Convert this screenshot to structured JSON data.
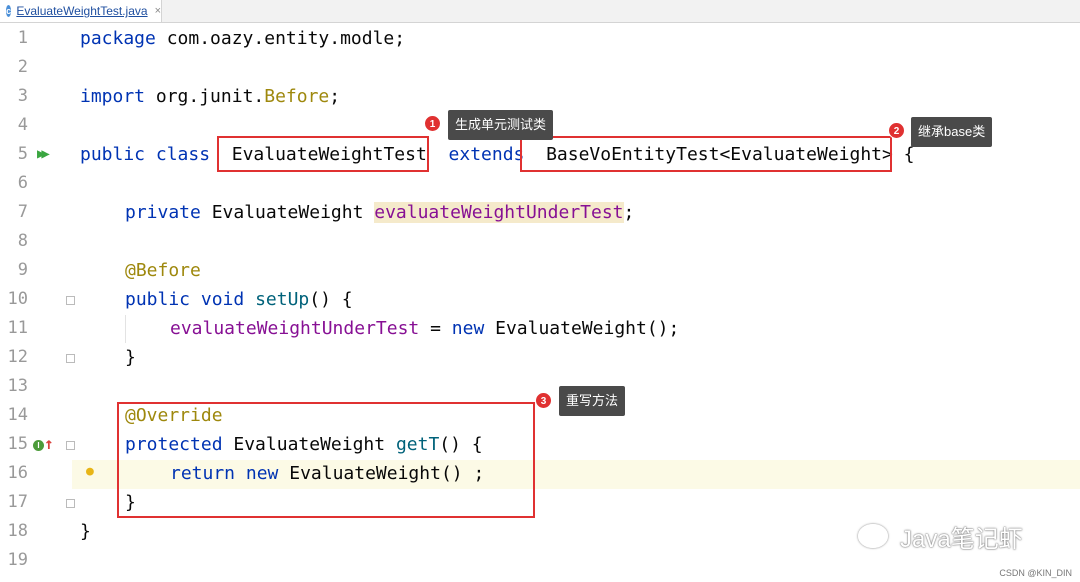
{
  "tab": {
    "filename": "EvaluateWeightTest.java",
    "icon": "java-class-icon",
    "close": "×"
  },
  "gutter": {
    "line_numbers": [
      "1",
      "2",
      "3",
      "4",
      "5",
      "6",
      "7",
      "8",
      "9",
      "10",
      "11",
      "12",
      "13",
      "14",
      "15",
      "16",
      "17",
      "18",
      "19"
    ]
  },
  "code": {
    "l1": {
      "kw": "package",
      "rest": " com.oazy.entity.modle;"
    },
    "l3": {
      "kw": "import",
      "pre": " org.junit.",
      "ann": "Before",
      "post": ";"
    },
    "l5": {
      "kw1": "public",
      "kw2": "class",
      "name": "EvaluateWeightTest",
      "kw3": "extends",
      "base": "BaseVoEntityTest<EvaluateWeight>",
      "brace": " {"
    },
    "l7": {
      "kw": "private",
      "type": " EvaluateWeight ",
      "field": "evaluateWeightUnderTest",
      "semi": ";"
    },
    "l9": {
      "ann": "@Before"
    },
    "l10": {
      "kw1": "public",
      "kw2": "void",
      "meth": "setUp",
      "rest": "() {"
    },
    "l11": {
      "field": "evaluateWeightUnderTest",
      "eq": " = ",
      "kw": "new",
      "rest": " EvaluateWeight();"
    },
    "l12": {
      "text": "}"
    },
    "l14": {
      "ann": "@Override"
    },
    "l15": {
      "kw": "protected",
      "type": " EvaluateWeight ",
      "meth": "getT",
      "rest": "() {"
    },
    "l16": {
      "kw1": "return",
      "kw2": "new",
      "rest": " EvaluateWeight() ;"
    },
    "l17": {
      "text": "}"
    },
    "l18": {
      "text": "}"
    }
  },
  "callouts": [
    {
      "num": "1",
      "text": "生成单元测试类"
    },
    {
      "num": "2",
      "text": "继承base类"
    },
    {
      "num": "3",
      "text": "重写方法"
    }
  ],
  "watermark": {
    "text": "Java笔记虾",
    "credit": "CSDN @KIN_DIN"
  },
  "colors": {
    "keyword": "#0033b3",
    "annotation": "#9e880d",
    "field": "#871094",
    "method": "#00627a",
    "callout_border": "#e03131",
    "callout_bg": "#4a4a4a"
  }
}
